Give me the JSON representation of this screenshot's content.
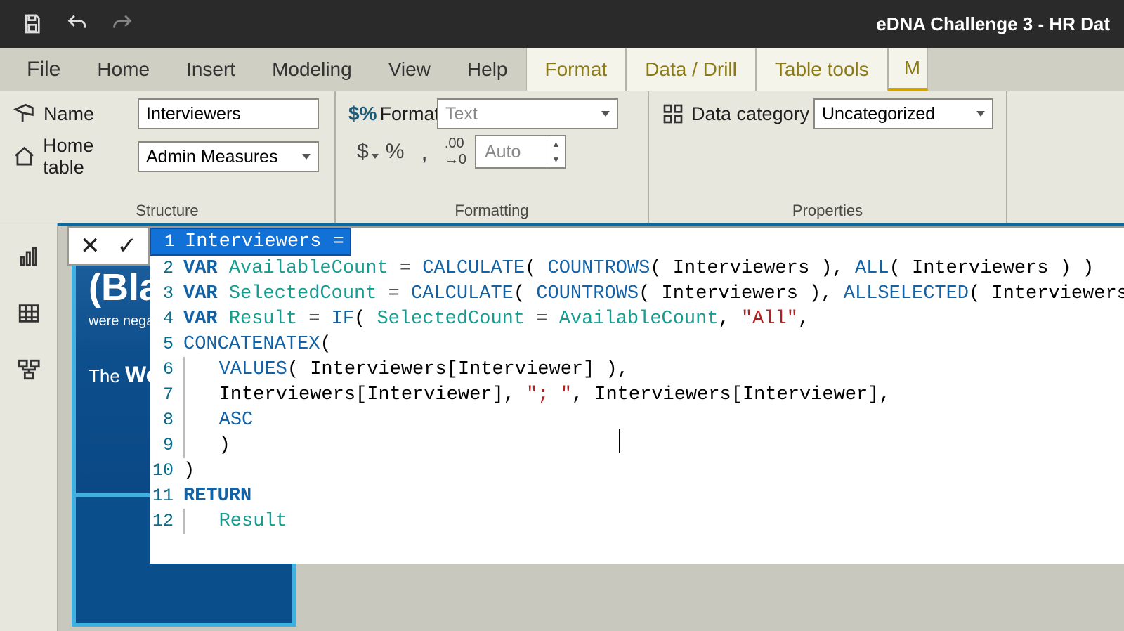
{
  "window_title": "eDNA Challenge 3 - HR Dat",
  "tabs": {
    "file": "File",
    "home": "Home",
    "insert": "Insert",
    "modeling": "Modeling",
    "view": "View",
    "help": "Help",
    "format": "Format",
    "datadrill": "Data / Drill",
    "tabletools": "Table tools",
    "measuretools": "M"
  },
  "ribbon": {
    "name_label": "Name",
    "name_value": "Interviewers",
    "home_table_label": "Home table",
    "home_table_value": "Admin Measures",
    "structure_group": "Structure",
    "format_label": "Format",
    "format_value": "Text",
    "decimal_value": "Auto",
    "formatting_group": "Formatting",
    "datacat_label": "Data category",
    "datacat_value": "Uncategorized",
    "properties_group": "Properties"
  },
  "tile": {
    "title": "(Blank)",
    "sub": "were negativ",
    "line3_pre": "The ",
    "line3_bold": "Worki"
  },
  "dax": {
    "lines": [
      {
        "n": 1,
        "tokens": [
          [
            "id",
            "Interviewers"
          ],
          [
            "plain",
            " "
          ],
          [
            "op",
            "="
          ]
        ]
      },
      {
        "n": 2,
        "tokens": [
          [
            "var",
            "VAR "
          ],
          [
            "id",
            "AvailableCount"
          ],
          [
            "plain",
            " "
          ],
          [
            "op",
            "="
          ],
          [
            "plain",
            " "
          ],
          [
            "fn",
            "CALCULATE"
          ],
          [
            "plain",
            "( "
          ],
          [
            "fn",
            "COUNTROWS"
          ],
          [
            "plain",
            "( Interviewers ), "
          ],
          [
            "fn",
            "ALL"
          ],
          [
            "plain",
            "( Interviewers ) )"
          ]
        ]
      },
      {
        "n": 3,
        "tokens": [
          [
            "var",
            "VAR "
          ],
          [
            "id",
            "SelectedCount"
          ],
          [
            "plain",
            " "
          ],
          [
            "op",
            "="
          ],
          [
            "plain",
            " "
          ],
          [
            "fn",
            "CALCULATE"
          ],
          [
            "plain",
            "( "
          ],
          [
            "fn",
            "COUNTROWS"
          ],
          [
            "plain",
            "( Interviewers ), "
          ],
          [
            "fn",
            "ALLSELECTED"
          ],
          [
            "plain",
            "( Interviewers ) )"
          ]
        ]
      },
      {
        "n": 4,
        "tokens": [
          [
            "var",
            "VAR "
          ],
          [
            "id",
            "Result"
          ],
          [
            "plain",
            " "
          ],
          [
            "op",
            "="
          ],
          [
            "plain",
            " "
          ],
          [
            "fn",
            "IF"
          ],
          [
            "plain",
            "( "
          ],
          [
            "id",
            "SelectedCount"
          ],
          [
            "plain",
            " "
          ],
          [
            "op",
            "="
          ],
          [
            "plain",
            " "
          ],
          [
            "id",
            "AvailableCount"
          ],
          [
            "plain",
            ", "
          ],
          [
            "str",
            "\"All\""
          ],
          [
            "plain",
            ","
          ]
        ]
      },
      {
        "n": 5,
        "tokens": [
          [
            "fn",
            "CONCATENATEX"
          ],
          [
            "plain",
            "("
          ]
        ]
      },
      {
        "n": 6,
        "indent": 1,
        "tokens": [
          [
            "plain",
            "   "
          ],
          [
            "fn",
            "VALUES"
          ],
          [
            "plain",
            "( Interviewers[Interviewer] ),"
          ]
        ]
      },
      {
        "n": 7,
        "indent": 1,
        "tokens": [
          [
            "plain",
            "   Interviewers[Interviewer], "
          ],
          [
            "str",
            "\"; \""
          ],
          [
            "plain",
            ", Interviewers[Interviewer],"
          ]
        ]
      },
      {
        "n": 8,
        "indent": 1,
        "tokens": [
          [
            "plain",
            "   "
          ],
          [
            "fn",
            "ASC"
          ]
        ]
      },
      {
        "n": 9,
        "indent": 1,
        "tokens": [
          [
            "plain",
            "   )"
          ]
        ]
      },
      {
        "n": 10,
        "tokens": [
          [
            "plain",
            ")"
          ]
        ]
      },
      {
        "n": 11,
        "tokens": [
          [
            "var",
            "RETURN"
          ]
        ]
      },
      {
        "n": 12,
        "indent": 1,
        "tokens": [
          [
            "plain",
            "   "
          ],
          [
            "id",
            "Result"
          ]
        ]
      }
    ]
  }
}
